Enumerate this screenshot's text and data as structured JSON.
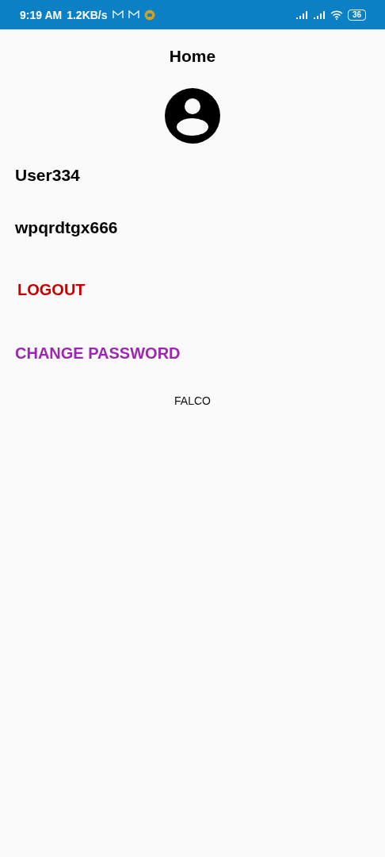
{
  "status_bar": {
    "time": "9:19 AM",
    "speed": "1.2KB/s",
    "battery": "36"
  },
  "title": "Home",
  "username": "User334",
  "password": "wpqrdtgx666",
  "actions": [
    {
      "label": "LOGOUT",
      "kind": "danger"
    },
    {
      "label": "CHANGE PASSWORD",
      "kind": "primary"
    }
  ],
  "footer": "FALCO"
}
